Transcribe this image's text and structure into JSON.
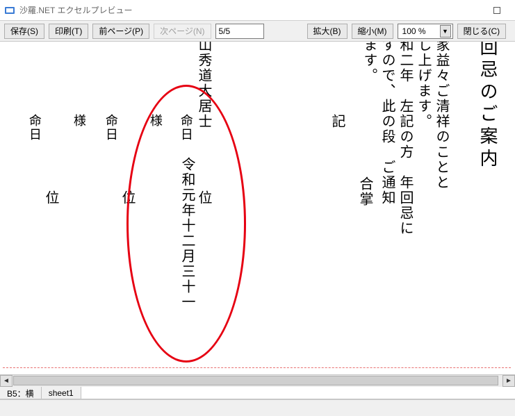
{
  "window": {
    "title": "沙羅.NET エクセルプレビュー"
  },
  "toolbar": {
    "save": "保存(S)",
    "print": "印刷(T)",
    "prev": "前ページ(P)",
    "next": "次ページ(N)",
    "page": "5/5",
    "zoom_in": "拡大(B)",
    "zoom_out": "縮小(M)",
    "zoom_value": "100 %",
    "close": "閉じる(C)"
  },
  "content": {
    "title_col": "回忌のご案内",
    "body1": "家益々ご清祥のことと",
    "body2": "し上げます。",
    "body3": "和二年　左記の方　年回忌に",
    "body4": "すので、此の段　ご通知",
    "body5": "ます。",
    "ki": "記",
    "gassho": "合掌",
    "name_col": "山秀道大居士",
    "kurai": "位",
    "meinichi": "命日",
    "sama": "様",
    "date_col": "令和元年十二月三十一"
  },
  "tabs": {
    "t1": "B5：横",
    "t2": "sheet1"
  }
}
